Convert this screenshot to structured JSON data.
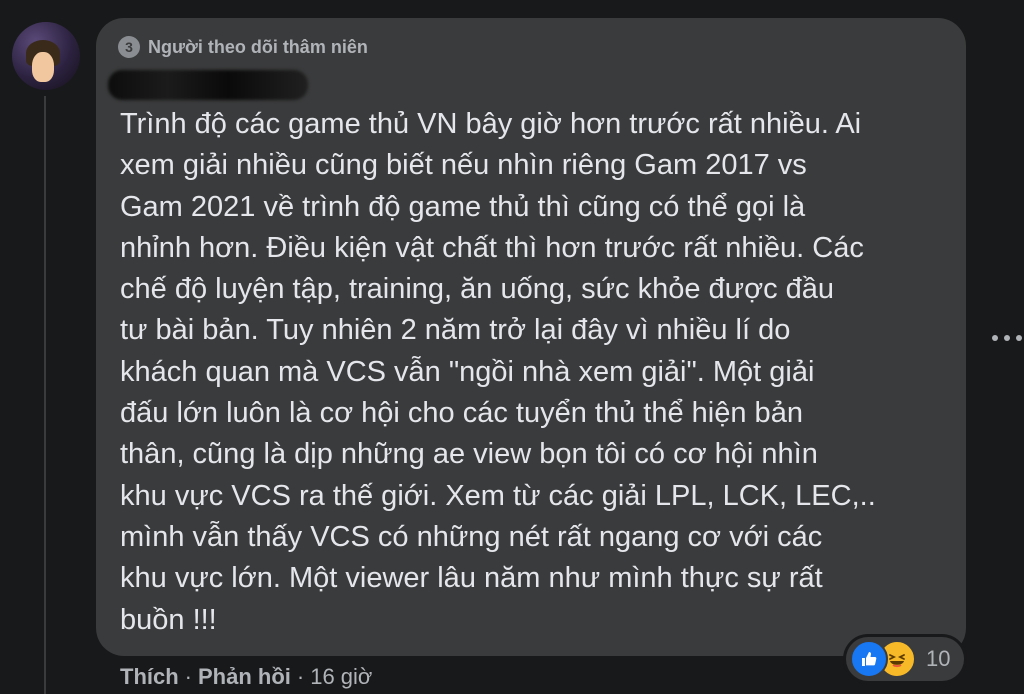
{
  "comment": {
    "badge": {
      "icon": "badge-3-icon",
      "number": "3",
      "label": "Người theo dõi thâm niên"
    },
    "author_name": "",
    "text": "Trình độ các game thủ VN bây giờ hơn trước rất nhiều. Ai\nxem giải nhiều cũng biết nếu nhìn riêng Gam 2017 vs\nGam 2021 về trình độ game thủ thì cũng có thể gọi là\nnhỉnh hơn. Điều kiện vật chất thì hơn trước rất nhiều. Các\nchế độ luyện tập, training, ăn uống, sức khỏe được đầu\ntư bài bản. Tuy nhiên 2 năm trở lại đây vì nhiều lí do\nkhách quan mà VCS vẫn \"ngồi nhà xem giải\". Một giải\nđấu lớn luôn là cơ hội cho các tuyển thủ thể hiện bản\nthân, cũng là dịp những ae view bọn tôi có cơ hội nhìn\nkhu vực VCS ra thế giới. Xem từ các giải LPL, LCK, LEC,..\nmình vẫn thấy VCS có những nét rất ngang cơ với các\nkhu vực lớn. Một viewer lâu năm như mình thực sự rất\nbuồn !!!"
  },
  "actions": {
    "like_label": "Thích",
    "separator_1": "·",
    "reply_label": "Phản hồi",
    "separator_2": "·",
    "time": "16 giờ"
  },
  "reactions": {
    "icons": [
      "like-icon",
      "haha-icon"
    ],
    "count": "10"
  },
  "colors": {
    "background": "#18191a",
    "bubble": "#3a3b3c",
    "text": "#e4e6eb",
    "secondary_text": "#b0b3b8",
    "like_blue": "#1877f2",
    "haha_yellow": "#f7b928"
  }
}
